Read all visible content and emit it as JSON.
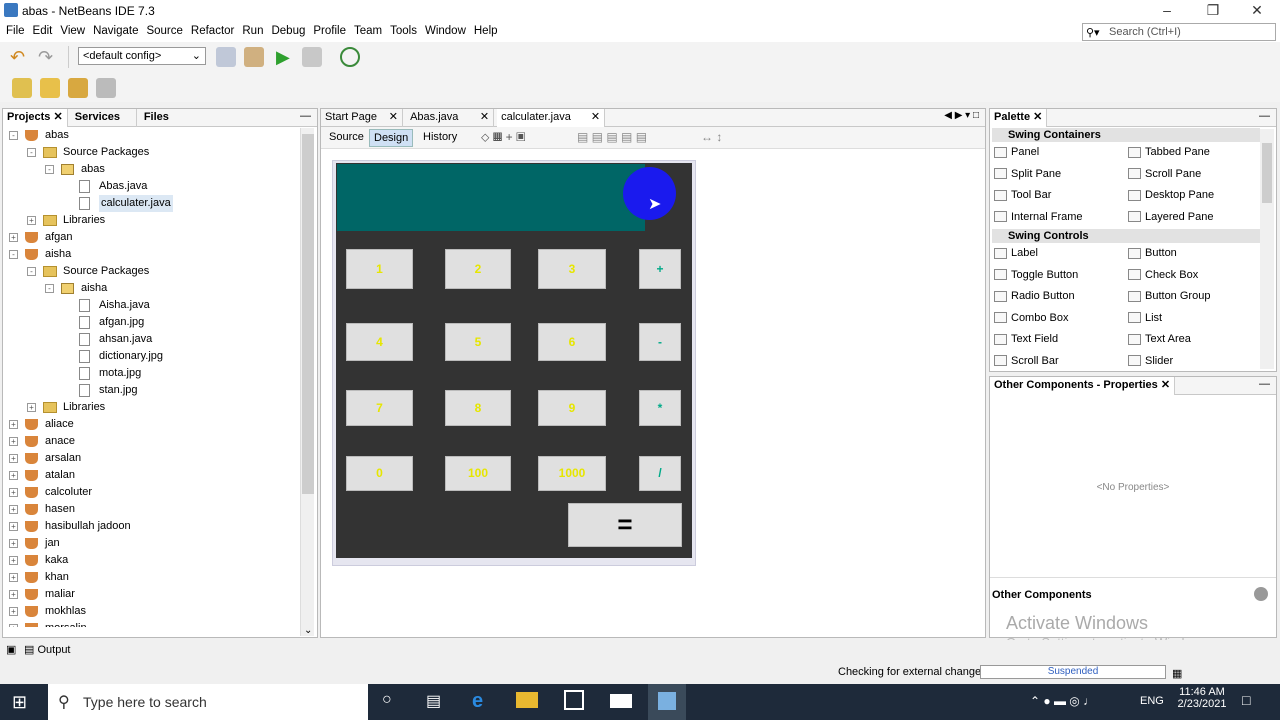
{
  "window": {
    "title": "abas - NetBeans IDE 7.3"
  },
  "menu": [
    "File",
    "Edit",
    "View",
    "Navigate",
    "Source",
    "Refactor",
    "Run",
    "Debug",
    "Profile",
    "Team",
    "Tools",
    "Window",
    "Help"
  ],
  "search": {
    "placeholder": "Search (Ctrl+I)"
  },
  "toolbar": {
    "config": "<default config>"
  },
  "left_tabs": [
    "Projects",
    "Services",
    "Files"
  ],
  "tree": [
    {
      "label": "abas",
      "level": 0,
      "kind": "project",
      "exp": "-"
    },
    {
      "label": "Source Packages",
      "level": 1,
      "kind": "folder",
      "exp": "-"
    },
    {
      "label": "abas",
      "level": 2,
      "kind": "pkg",
      "exp": "-"
    },
    {
      "label": "Abas.java",
      "level": 3,
      "kind": "file"
    },
    {
      "label": "calculater.java",
      "level": 3,
      "kind": "file",
      "selected": true
    },
    {
      "label": "Libraries",
      "level": 1,
      "kind": "folder",
      "exp": "+"
    },
    {
      "label": "afgan",
      "level": 0,
      "kind": "project",
      "exp": "+"
    },
    {
      "label": "aisha",
      "level": 0,
      "kind": "project",
      "exp": "-"
    },
    {
      "label": "Source Packages",
      "level": 1,
      "kind": "folder",
      "exp": "-"
    },
    {
      "label": "aisha",
      "level": 2,
      "kind": "pkg",
      "exp": "-"
    },
    {
      "label": "Aisha.java",
      "level": 3,
      "kind": "file"
    },
    {
      "label": "afgan.jpg",
      "level": 3,
      "kind": "file"
    },
    {
      "label": "ahsan.java",
      "level": 3,
      "kind": "file"
    },
    {
      "label": "dictionary.jpg",
      "level": 3,
      "kind": "file"
    },
    {
      "label": "mota.jpg",
      "level": 3,
      "kind": "file"
    },
    {
      "label": "stan.jpg",
      "level": 3,
      "kind": "file"
    },
    {
      "label": "Libraries",
      "level": 1,
      "kind": "folder",
      "exp": "+"
    },
    {
      "label": "aliace",
      "level": 0,
      "kind": "project",
      "exp": "+"
    },
    {
      "label": "anace",
      "level": 0,
      "kind": "project",
      "exp": "+"
    },
    {
      "label": "arsalan",
      "level": 0,
      "kind": "project",
      "exp": "+"
    },
    {
      "label": "atalan",
      "level": 0,
      "kind": "project",
      "exp": "+"
    },
    {
      "label": "calcoluter",
      "level": 0,
      "kind": "project",
      "exp": "+"
    },
    {
      "label": "hasen",
      "level": 0,
      "kind": "project",
      "exp": "+"
    },
    {
      "label": "hasibullah jadoon",
      "level": 0,
      "kind": "project",
      "exp": "+"
    },
    {
      "label": "jan",
      "level": 0,
      "kind": "project",
      "exp": "+"
    },
    {
      "label": "kaka",
      "level": 0,
      "kind": "project",
      "exp": "+"
    },
    {
      "label": "khan",
      "level": 0,
      "kind": "project",
      "exp": "+"
    },
    {
      "label": "maliar",
      "level": 0,
      "kind": "project",
      "exp": "+"
    },
    {
      "label": "mokhlas",
      "level": 0,
      "kind": "project",
      "exp": "+"
    },
    {
      "label": "morsalin",
      "level": 0,
      "kind": "project",
      "exp": "+"
    }
  ],
  "editor_tabs": [
    "Start Page",
    "Abas.java",
    "calculater.java"
  ],
  "editor_subtabs": [
    "Source",
    "Design",
    "History"
  ],
  "calc_buttons": [
    {
      "label": "1",
      "op": false
    },
    {
      "label": "2",
      "op": false
    },
    {
      "label": "3",
      "op": false
    },
    {
      "label": "+",
      "op": true
    },
    {
      "label": "4",
      "op": false
    },
    {
      "label": "5",
      "op": false
    },
    {
      "label": "6",
      "op": false
    },
    {
      "label": "-",
      "op": true
    },
    {
      "label": "7",
      "op": false
    },
    {
      "label": "8",
      "op": false
    },
    {
      "label": "9",
      "op": false
    },
    {
      "label": "*",
      "op": true
    },
    {
      "label": "0",
      "op": false
    },
    {
      "label": "100",
      "op": false
    },
    {
      "label": "1000",
      "op": false
    },
    {
      "label": "/",
      "op": true
    }
  ],
  "equals": "=",
  "palette": {
    "title": "Palette",
    "cat1": "Swing Containers",
    "containers": [
      "Panel",
      "Tabbed Pane",
      "Split Pane",
      "Scroll Pane",
      "Tool Bar",
      "Desktop Pane",
      "Internal Frame",
      "Layered Pane"
    ],
    "cat2": "Swing Controls",
    "controls": [
      "Label",
      "Button",
      "Toggle Button",
      "Check Box",
      "Radio Button",
      "Button Group",
      "Combo Box",
      "List",
      "Text Field",
      "Text Area",
      "Scroll Bar",
      "Slider"
    ]
  },
  "props": {
    "title": "Other Components - Properties",
    "empty": "<No Properties>",
    "footer": "Other Components"
  },
  "watermark": {
    "line1": "Activate Windows",
    "line2": "Go to Settings to activate Windows."
  },
  "output_tab": "Output",
  "status": {
    "text": "Checking for external changes",
    "progress": "Suspended"
  },
  "taskbar": {
    "search": "Type here to search",
    "lang": "ENG",
    "time": "11:46 AM",
    "date": "2/23/2021"
  }
}
